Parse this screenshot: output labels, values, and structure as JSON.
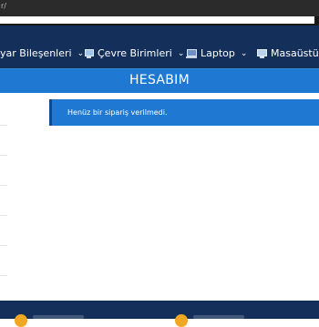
{
  "browser": {
    "address_fragment": "r/"
  },
  "navbar": {
    "items": [
      {
        "label": "yar Bileşenleri",
        "icon": "none"
      },
      {
        "label": "Çevre Birimleri",
        "icon": "peripheral-icon"
      },
      {
        "label": "Laptop",
        "icon": "laptop-icon"
      },
      {
        "label": "Masaüstü Bi",
        "icon": "desktop-icon"
      }
    ]
  },
  "page": {
    "title": "HESABIM"
  },
  "orders": {
    "empty_message": "Henüz bir sipariş verilmedi."
  },
  "colors": {
    "navbar_bg": "#14305a",
    "accent_blue": "#1f78d1",
    "footer_badge": "#f0a823"
  }
}
